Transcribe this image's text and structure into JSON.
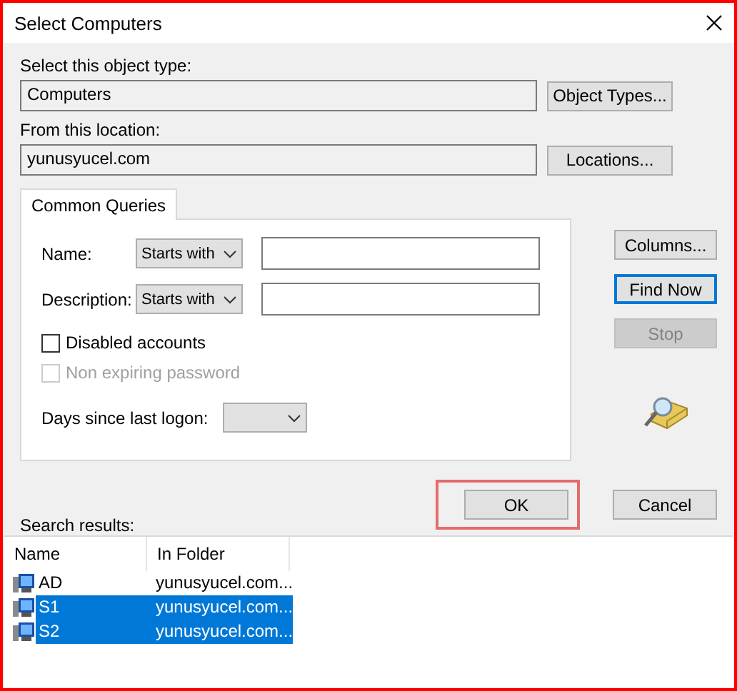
{
  "window": {
    "title": "Select Computers"
  },
  "object_type": {
    "label": "Select this object type:",
    "value": "Computers",
    "button": "Object Types..."
  },
  "location": {
    "label": "From this location:",
    "value": "yunusyucel.com",
    "button": "Locations..."
  },
  "tabs": [
    {
      "label": "Common Queries",
      "selected": true
    }
  ],
  "queries": [
    {
      "label": "Name:",
      "mode": "Starts with"
    },
    {
      "label": "Description:",
      "mode": "Starts with"
    }
  ],
  "checkboxes": [
    {
      "label": "Disabled accounts",
      "checked": false,
      "disabled": false
    },
    {
      "label": "Non expiring password",
      "checked": false,
      "disabled": true
    }
  ],
  "days": {
    "label": "Days since last logon:"
  },
  "side_buttons": [
    {
      "label": "Columns...",
      "focused": false,
      "disabled": false
    },
    {
      "label": "Find Now",
      "focused": true,
      "disabled": false
    },
    {
      "label": "Stop",
      "focused": false,
      "disabled": true
    }
  ],
  "dialog_buttons": [
    {
      "label": "OK",
      "highlighted": true
    },
    {
      "label": "Cancel",
      "highlighted": false
    }
  ],
  "results": {
    "label": "Search results:",
    "columns": [
      "Name",
      "In Folder"
    ],
    "rows": [
      {
        "name": "AD",
        "folder": "yunusyucel.com...",
        "selected": false
      },
      {
        "name": "S1",
        "folder": "yunusyucel.com...",
        "selected": true
      },
      {
        "name": "S2",
        "folder": "yunusyucel.com...",
        "selected": true
      }
    ]
  }
}
